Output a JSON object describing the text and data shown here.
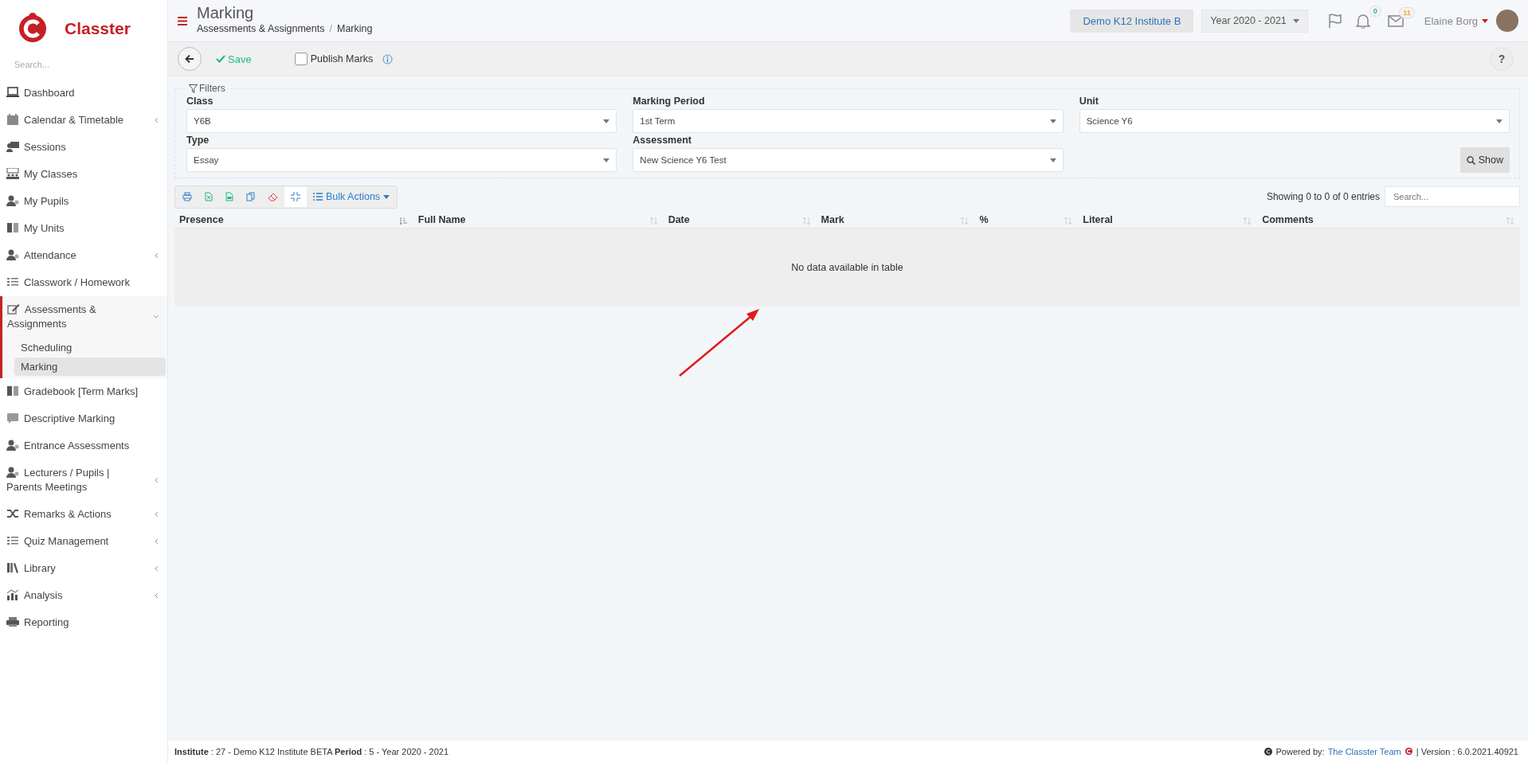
{
  "brand": {
    "name": "Classter"
  },
  "sidebar": {
    "search_placeholder": "Search...",
    "items": [
      {
        "label": "Dashboard",
        "expandable": false,
        "expanded": false
      },
      {
        "label": "Calendar & Timetable",
        "expandable": true,
        "expanded": false
      },
      {
        "label": "Sessions",
        "expandable": false,
        "expanded": false
      },
      {
        "label": "My Classes",
        "expandable": false,
        "expanded": false
      },
      {
        "label": "My Pupils",
        "expandable": false,
        "expanded": false
      },
      {
        "label": "My Units",
        "expandable": false,
        "expanded": false
      },
      {
        "label": "Attendance",
        "expandable": true,
        "expanded": false
      },
      {
        "label": "Classwork / Homework",
        "expandable": false,
        "expanded": false
      },
      {
        "label": "Assessments & Assignments",
        "expandable": true,
        "expanded": true,
        "children": [
          {
            "label": "Scheduling",
            "selected": false
          },
          {
            "label": "Marking",
            "selected": true
          }
        ]
      },
      {
        "label": "Gradebook [Term Marks]",
        "expandable": false,
        "expanded": false
      },
      {
        "label": "Descriptive Marking",
        "expandable": false,
        "expanded": false
      },
      {
        "label": "Entrance Assessments",
        "expandable": false,
        "expanded": false
      },
      {
        "label": "Lecturers / Pupils | Parents Meetings",
        "expandable": true,
        "expanded": false
      },
      {
        "label": "Remarks & Actions",
        "expandable": true,
        "expanded": false
      },
      {
        "label": "Quiz Management",
        "expandable": true,
        "expanded": false
      },
      {
        "label": "Library",
        "expandable": true,
        "expanded": false
      },
      {
        "label": "Analysis",
        "expandable": true,
        "expanded": false
      },
      {
        "label": "Reporting",
        "expandable": false,
        "expanded": false
      }
    ]
  },
  "header": {
    "title": "Marking",
    "breadcrumb": [
      "Assessments & Assignments",
      "Marking"
    ],
    "breadcrumb_separator": "/",
    "institute": "Demo K12 Institute B",
    "year": "Year 2020 - 2021",
    "notifications": "0",
    "messages": "11",
    "user": "Elaine Borg"
  },
  "toolbar": {
    "save": "Save",
    "publish": {
      "label": "Publish Marks",
      "checked": false
    },
    "help": "?"
  },
  "filters": {
    "legend": "Filters",
    "fields": [
      {
        "label": "Class",
        "value": "Y6B"
      },
      {
        "label": "Marking Period",
        "value": "1st Term"
      },
      {
        "label": "Unit",
        "value": "Science Y6"
      },
      {
        "label": "Type",
        "value": "Essay"
      },
      {
        "label": "Assessment",
        "value": "New Science Y6 Test"
      }
    ],
    "show_button": "Show"
  },
  "table": {
    "bulk_actions": "Bulk Actions",
    "entries_info": "Showing 0 to 0 of 0 entries",
    "search_placeholder": "Search...",
    "columns": [
      {
        "label": "Presence",
        "sorted": true
      },
      {
        "label": "Full Name",
        "sorted": false
      },
      {
        "label": "Date",
        "sorted": false
      },
      {
        "label": "Mark",
        "sorted": false
      },
      {
        "label": "%",
        "sorted": false
      },
      {
        "label": "Literal",
        "sorted": false
      },
      {
        "label": "Comments",
        "sorted": false
      }
    ],
    "empty_message": "No data available in table"
  },
  "footer": {
    "info": "**Institute** : 27 - Demo K12 Institute BETA **Period** : 5 - Year 2020 - 2021",
    "powered_label": "Powered by:",
    "powered_link": "The Classter Team",
    "version": "| Version : 6.0.2021.40921"
  }
}
